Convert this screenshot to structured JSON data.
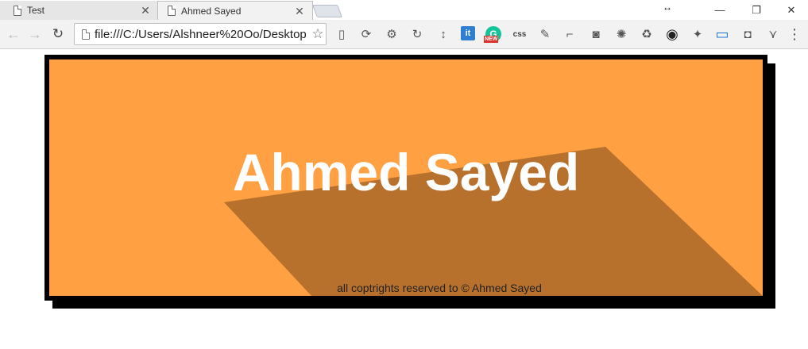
{
  "tabs": [
    {
      "title": "Test",
      "active": false
    },
    {
      "title": "Ahmed Sayed",
      "active": true
    }
  ],
  "window": {
    "resize_glyph": "↔",
    "minimize": "—",
    "restore": "❐",
    "close": "✕"
  },
  "toolbar": {
    "back": "←",
    "forward": "→",
    "reload": "↻",
    "url": "file:///C:/Users/Alshneer%20Oo/Desktop",
    "star": "☆"
  },
  "extensions": [
    {
      "name": "no-phone-icon",
      "glyph": "▯"
    },
    {
      "name": "rotate-icon",
      "glyph": "⟳"
    },
    {
      "name": "gear-icon",
      "glyph": "⚙"
    },
    {
      "name": "sync-icon",
      "glyph": "↻"
    },
    {
      "name": "line-height-icon",
      "glyph": "↕"
    },
    {
      "name": "it-icon",
      "glyph": "it"
    },
    {
      "name": "grammarly-icon",
      "glyph": "G",
      "badge": "NEW"
    },
    {
      "name": "css-icon",
      "glyph": "css"
    },
    {
      "name": "eyedropper-icon",
      "glyph": "✎"
    },
    {
      "name": "ruler-icon",
      "glyph": "⌐"
    },
    {
      "name": "camera-icon",
      "glyph": "◙"
    },
    {
      "name": "cog-wheel-icon",
      "glyph": "✺"
    },
    {
      "name": "recycle-icon",
      "glyph": "♻"
    },
    {
      "name": "color-wheel-icon",
      "glyph": "◉"
    },
    {
      "name": "satellite-icon",
      "glyph": "✦"
    },
    {
      "name": "window-icon",
      "glyph": "▭"
    },
    {
      "name": "pocket-icon",
      "glyph": "◘"
    },
    {
      "name": "vue-icon",
      "glyph": "⋎"
    },
    {
      "name": "menu-icon",
      "glyph": "⋮"
    }
  ],
  "page": {
    "heading": "Ahmed Sayed",
    "footer": "all coptrights reserved to © Ahmed Sayed"
  },
  "colors": {
    "banner_bg": "#ffa043",
    "long_shadow": "#b8712c",
    "heading": "#ffffff",
    "frame": "#000000"
  }
}
